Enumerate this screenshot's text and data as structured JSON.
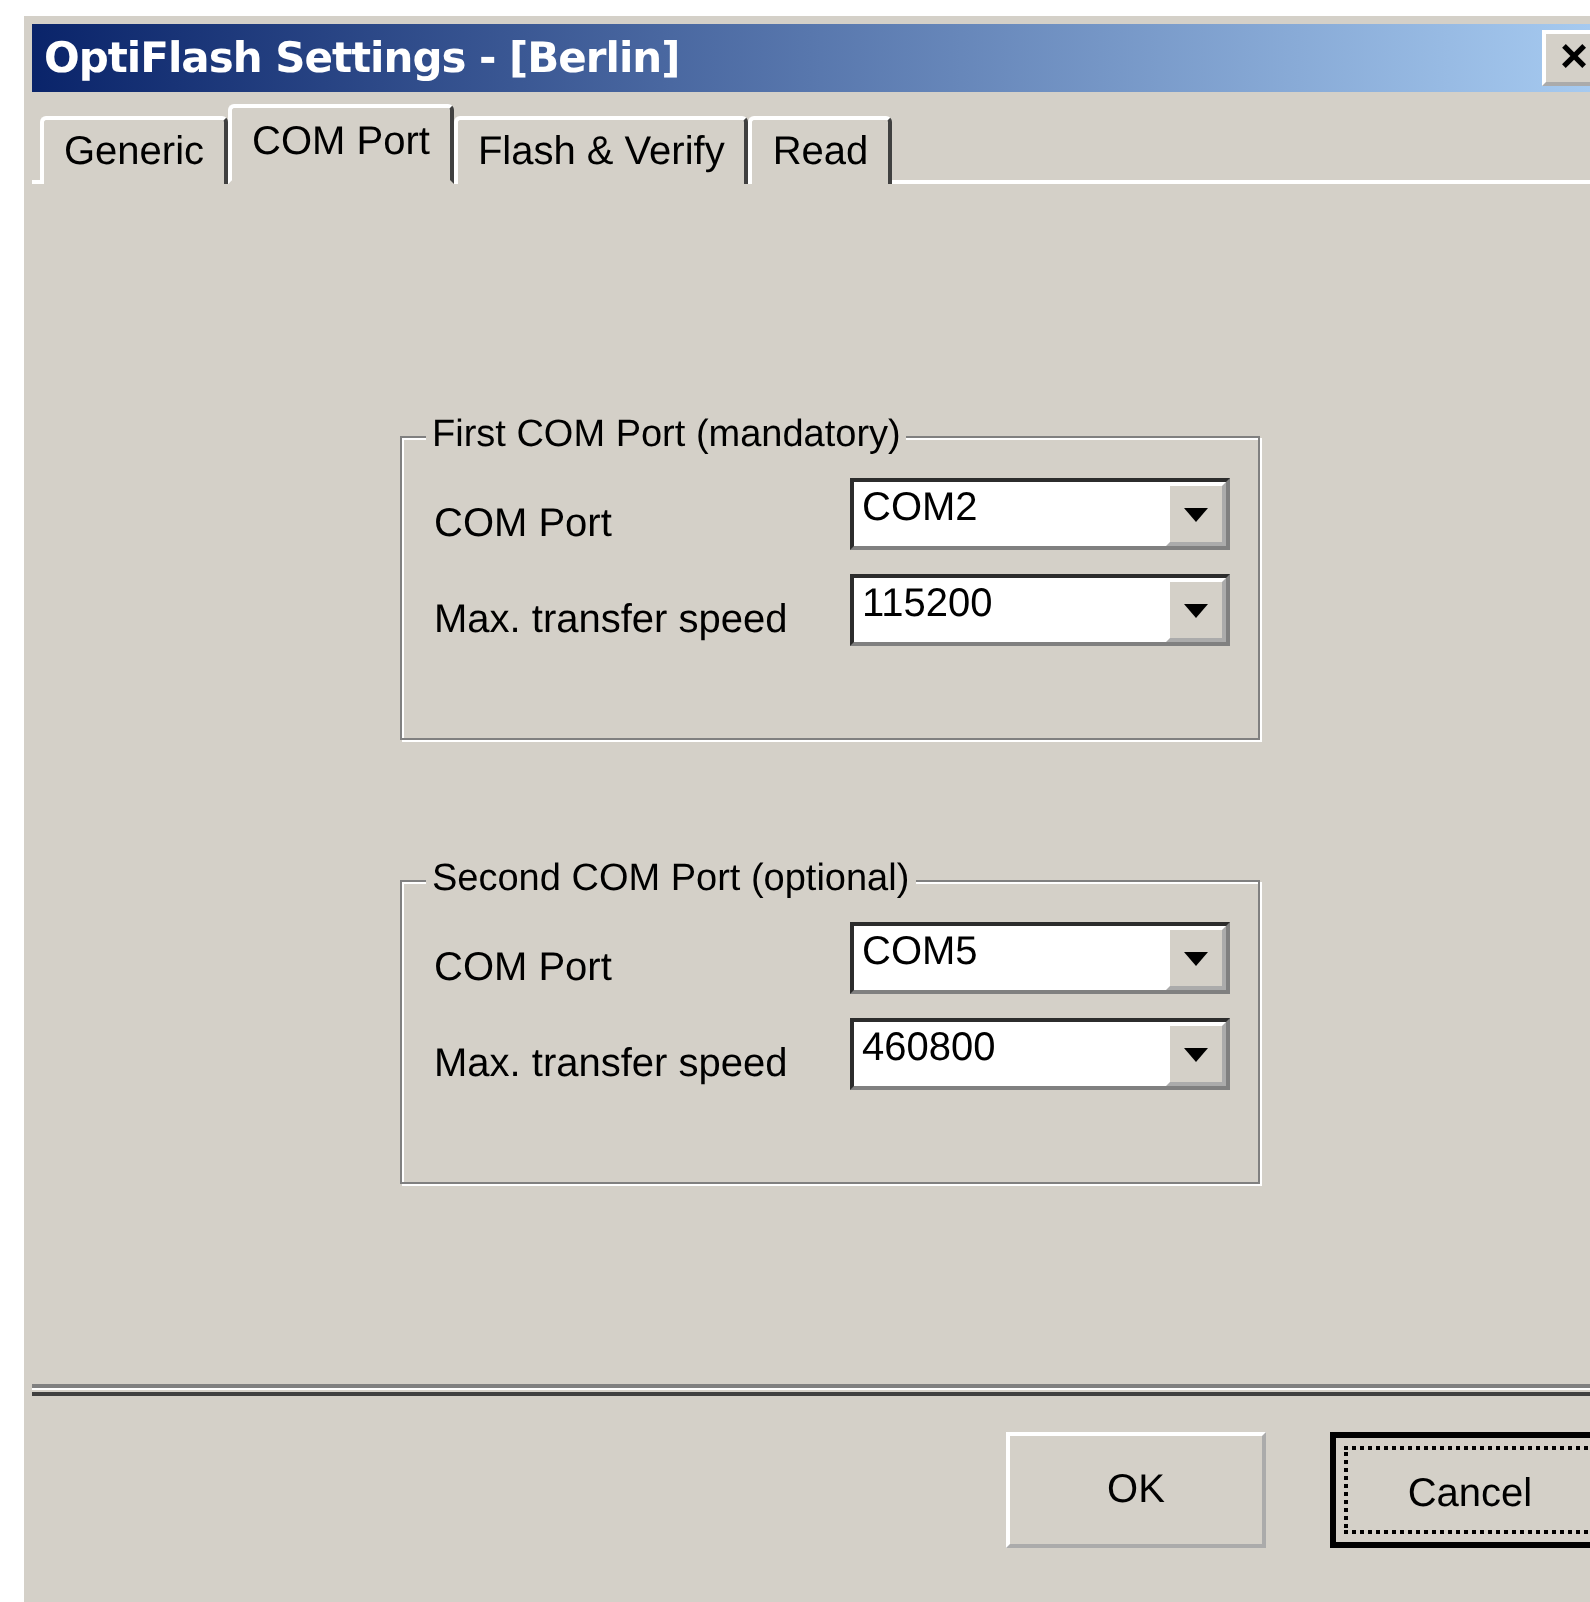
{
  "window": {
    "title": "OptiFlash Settings - [Berlin]",
    "close_glyph": "×"
  },
  "tabs": [
    {
      "label": "Generic",
      "selected": false
    },
    {
      "label": "COM Port",
      "selected": true
    },
    {
      "label": "Flash & Verify",
      "selected": false
    },
    {
      "label": "Read",
      "selected": false
    }
  ],
  "groups": [
    {
      "title": "First COM Port (mandatory)",
      "fields": [
        {
          "label": "COM Port",
          "value": "COM2"
        },
        {
          "label": "Max. transfer speed",
          "value": "115200"
        }
      ]
    },
    {
      "title": "Second COM Port (optional)",
      "fields": [
        {
          "label": "COM Port",
          "value": "COM5"
        },
        {
          "label": "Max. transfer speed",
          "value": "460800"
        }
      ]
    }
  ],
  "buttons": [
    {
      "label": "OK",
      "focused": false
    },
    {
      "label": "Cancel",
      "focused": true
    }
  ]
}
